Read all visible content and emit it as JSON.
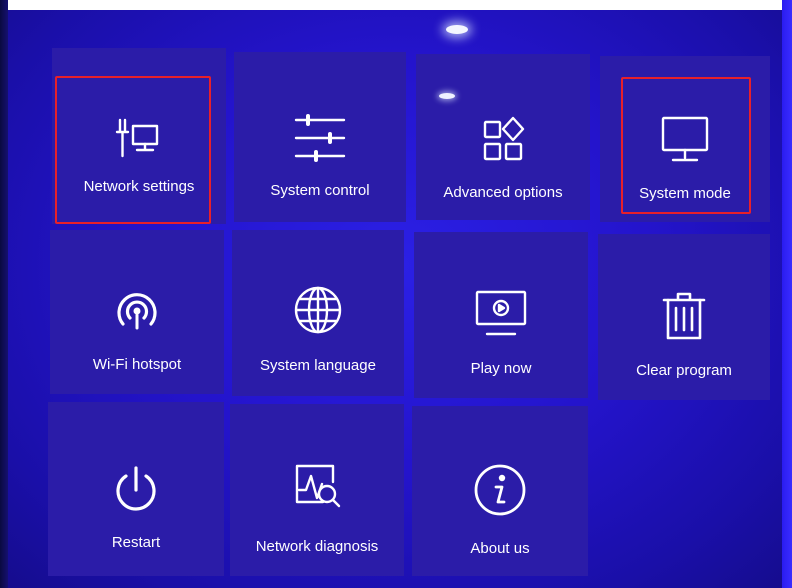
{
  "menu": {
    "tiles": [
      {
        "label": "Network settings",
        "icon": "network-settings-icon"
      },
      {
        "label": "System control",
        "icon": "sliders-icon"
      },
      {
        "label": "Advanced options",
        "icon": "apps-grid-icon"
      },
      {
        "label": "System mode",
        "icon": "monitor-icon"
      },
      {
        "label": "Wi-Fi hotspot",
        "icon": "hotspot-icon"
      },
      {
        "label": "System language",
        "icon": "globe-icon"
      },
      {
        "label": "Play now",
        "icon": "play-screen-icon"
      },
      {
        "label": "Clear program",
        "icon": "trash-icon"
      },
      {
        "label": "Restart",
        "icon": "power-icon"
      },
      {
        "label": "Network diagnosis",
        "icon": "diagnosis-icon"
      },
      {
        "label": "About us",
        "icon": "info-icon"
      }
    ]
  },
  "colors": {
    "background": "#2414cc",
    "tile": "#2b1ca8",
    "highlight": "#e8202a",
    "text": "#ffffff"
  }
}
